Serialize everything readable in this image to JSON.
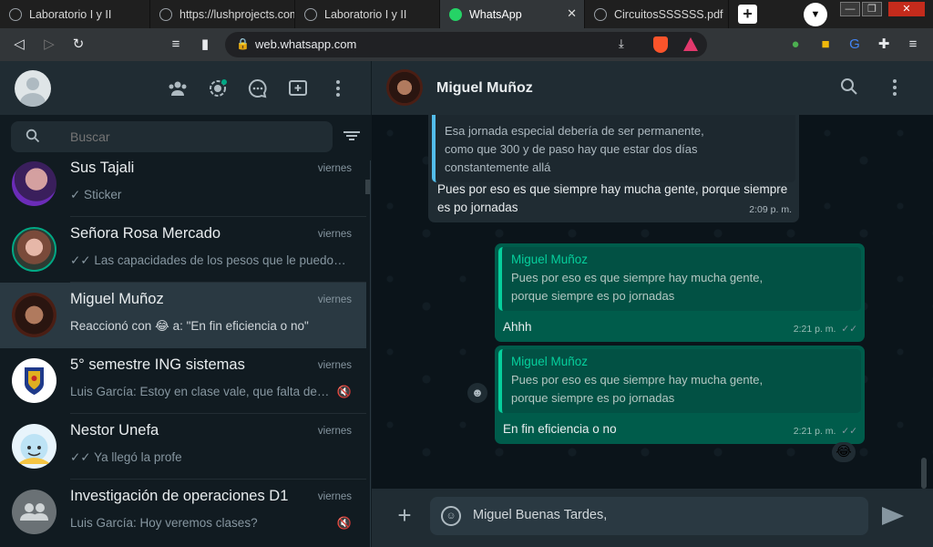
{
  "browser": {
    "tabs": [
      {
        "title": "Laboratorio I y II",
        "favicon": "globe-icon",
        "active": false
      },
      {
        "title": "https://lushprojects.com",
        "favicon": "globe-icon",
        "active": false
      },
      {
        "title": "Laboratorio I y II",
        "favicon": "globe-icon",
        "active": false
      },
      {
        "title": "WhatsApp",
        "favicon": "whatsapp-icon",
        "active": true
      },
      {
        "title": "CircuitosSSSSSS.pdf",
        "favicon": "globe-icon",
        "active": false
      }
    ],
    "url": "web.whatsapp.com"
  },
  "sidebar": {
    "search_placeholder": "Buscar",
    "chats": [
      {
        "name": "Sus Tajali",
        "time": "viernes",
        "preview": "✓ Sticker",
        "muted": false,
        "selected": false
      },
      {
        "name": "Señora Rosa Mercado",
        "time": "viernes",
        "preview": "✓✓ Las capacidades de los pesos que le puedo o...",
        "muted": false,
        "selected": false
      },
      {
        "name": "Miguel Muñoz",
        "time": "viernes",
        "preview": "Reaccionó con 😂 a: \"En fin eficiencia o no\"",
        "muted": false,
        "selected": true
      },
      {
        "name": "5° semestre ING sistemas",
        "time": "viernes",
        "preview": "Luis García: Estoy en clase vale, que falta de f...",
        "muted": true,
        "selected": false
      },
      {
        "name": "Nestor Unefa",
        "time": "viernes",
        "preview": "✓✓ Ya llegó la profe",
        "muted": false,
        "selected": false
      },
      {
        "name": "Investigación de operaciones D1",
        "time": "viernes",
        "preview": "Luis García: Hoy veremos clases?",
        "muted": true,
        "selected": false
      }
    ]
  },
  "conversation": {
    "contact_name": "Miguel Muñoz",
    "messages": [
      {
        "direction": "in",
        "quote_text": "Esa jornada especial debería de ser permanente, como que 300 y de paso hay que estar dos días constantemente allá",
        "quote_lines": [
          "Esa jornada especial debería de ser permanente,",
          "como que 300 y de paso hay que estar dos días",
          "constantemente allá"
        ],
        "text_lines": [
          "Pues por eso es que siempre hay mucha gente, porque siempre",
          "es po jornadas"
        ],
        "time": "2:09 p. m."
      },
      {
        "direction": "out",
        "quote_name": "Miguel Muñoz",
        "quote_lines": [
          "Pues por eso es que siempre hay mucha gente,",
          "porque siempre es po jornadas"
        ],
        "text": "Ahhh",
        "time": "2:21 p. m.",
        "ticks": "✓✓"
      },
      {
        "direction": "out",
        "quote_name": "Miguel Muñoz",
        "quote_lines": [
          "Pues por eso es que siempre hay mucha gente,",
          "porque siempre es po jornadas"
        ],
        "text": "En fin eficiencia o no",
        "time": "2:21 p. m.",
        "ticks": "✓✓",
        "reaction": "😂"
      }
    ],
    "composer_text": "Miguel Buenas Tardes,"
  },
  "colors": {
    "accent": "#00a884",
    "panel": "#202c33",
    "background": "#111b21",
    "outgoing": "#005c4b"
  }
}
